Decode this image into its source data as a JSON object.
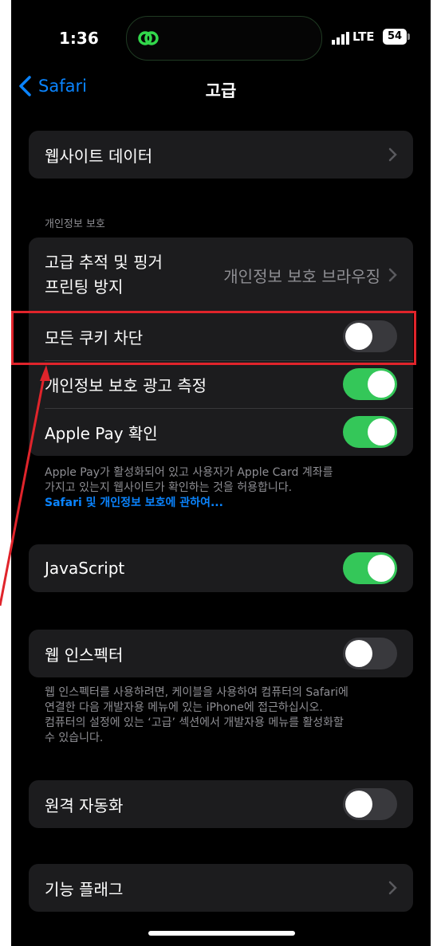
{
  "status_bar": {
    "time": "1:36",
    "network": "LTE",
    "battery": "54",
    "island_icon": "link-loop-icon"
  },
  "nav": {
    "back_label": "Safari",
    "title": "고급"
  },
  "group_website_data": {
    "label": "웹사이트 데이터"
  },
  "privacy_section": {
    "header": "개인정보 보호",
    "tracking_label_line1": "고급 추적 및 핑거",
    "tracking_label_line2": "프린팅 방지",
    "tracking_value": "개인정보 보호 브라우징",
    "block_cookies_label": "모든 쿠키 차단",
    "block_cookies_on": false,
    "ad_measurement_label": "개인정보 보호 광고 측정",
    "ad_measurement_on": true,
    "apple_pay_label": "Apple Pay 확인",
    "apple_pay_on": true,
    "footer_line1": "Apple Pay가 활성화되어 있고 사용자가 Apple Card 계좌를",
    "footer_line2": "가지고 있는지 웹사이트가 확인하는 것을 허용합니다.",
    "footer_link": "Safari 및 개인정보 보호에 관하여..."
  },
  "javascript": {
    "label": "JavaScript",
    "on": true
  },
  "web_inspector": {
    "label": "웹 인스펙터",
    "on": false,
    "footer_line1": "웹 인스펙터를 사용하려면, 케이블을 사용하여 컴퓨터의 Safari에",
    "footer_line2": "연결한 다음 개발자용 메뉴에 있는 iPhone에 접근하십시오.",
    "footer_line3": "컴퓨터의 설정에 있는 ‘고급’ 섹션에서 개발자용 메뉴를 활성화할",
    "footer_line4": "수 있습니다."
  },
  "remote_automation": {
    "label": "원격 자동화",
    "on": false
  },
  "feature_flags": {
    "label": "기능 플래그"
  },
  "colors": {
    "background": "#000000",
    "cell": "#1c1c1e",
    "accent_blue": "#0a84ff",
    "toggle_on": "#34c759",
    "annotation_red": "#e0242b"
  }
}
